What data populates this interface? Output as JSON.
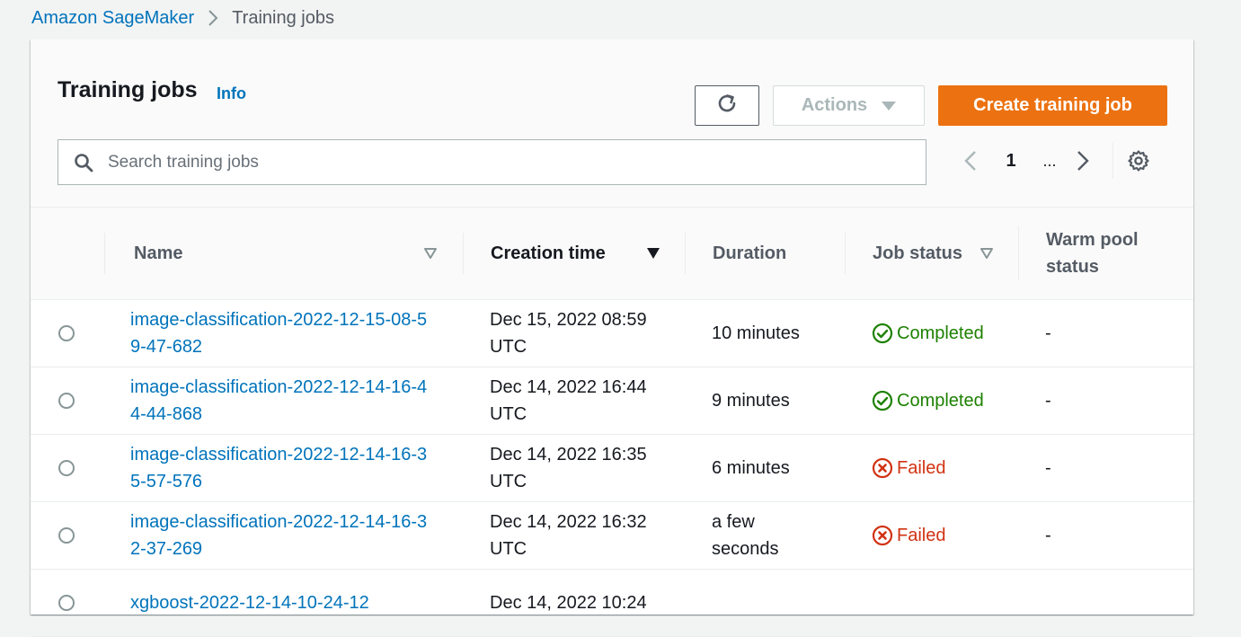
{
  "breadcrumb": {
    "root": "Amazon SageMaker",
    "current": "Training jobs"
  },
  "header": {
    "title": "Training jobs",
    "info": "Info",
    "actions_label": "Actions",
    "create_label": "Create training job"
  },
  "search": {
    "placeholder": "Search training jobs",
    "value": ""
  },
  "pagination": {
    "current_page": "1",
    "ellipsis": "..."
  },
  "table": {
    "columns": [
      "Name",
      "Creation time",
      "Duration",
      "Job status",
      "Warm pool status"
    ],
    "rows": [
      {
        "name": "image-classification-2022-12-15-08-59-47-682",
        "created": "Dec 15, 2022 08:59 UTC",
        "duration": "10 minutes",
        "status": "Completed",
        "warm_pool": "-"
      },
      {
        "name": "image-classification-2022-12-14-16-44-44-868",
        "created": "Dec 14, 2022 16:44 UTC",
        "duration": "9 minutes",
        "status": "Completed",
        "warm_pool": "-"
      },
      {
        "name": "image-classification-2022-12-14-16-35-57-576",
        "created": "Dec 14, 2022 16:35 UTC",
        "duration": "6 minutes",
        "status": "Failed",
        "warm_pool": "-"
      },
      {
        "name": "image-classification-2022-12-14-16-32-37-269",
        "created": "Dec 14, 2022 16:32 UTC",
        "duration": "a few seconds",
        "status": "Failed",
        "warm_pool": "-"
      },
      {
        "name": "xgboost-2022-12-14-10-24-12",
        "created": "Dec 14, 2022 10:24",
        "duration": "",
        "status": "",
        "warm_pool": ""
      }
    ]
  },
  "colors": {
    "link": "#0073bb",
    "primary_button": "#ec7211",
    "success": "#1d8102",
    "error": "#d13212"
  },
  "icons": [
    "chevron-right-icon",
    "refresh-icon",
    "caret-down-icon",
    "search-icon",
    "chevron-left-icon",
    "gear-icon",
    "sort-icon",
    "check-circle-icon",
    "x-circle-icon"
  ]
}
